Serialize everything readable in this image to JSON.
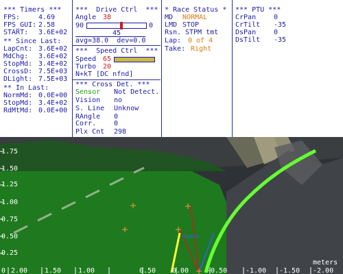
{
  "timers": {
    "header": "*** Timers ***",
    "rows": [
      {
        "label": "FPS:",
        "value": "4.69"
      },
      {
        "label": "FPS_GUI:",
        "value": "2.58"
      },
      {
        "label": "START:",
        "value": "3.6E+02"
      }
    ],
    "since_header": "** Since Last:",
    "since_rows": [
      {
        "label": "LapCnt:",
        "value": "3.6E+02"
      },
      {
        "label": "MdChg:",
        "value": "3.6E+02"
      },
      {
        "label": "StopMd:",
        "value": "3.4E+02"
      },
      {
        "label": "CrossD:",
        "value": "7.5E+03"
      },
      {
        "label": "DLight:",
        "value": "7.5E+03"
      }
    ],
    "in_header": "** In Last:",
    "in_rows": [
      {
        "label": "NormMd:",
        "value": "0.0E+00"
      },
      {
        "label": "StopMd:",
        "value": "3.4E+02"
      },
      {
        "label": "RdMtMd:",
        "value": "0.0E+00"
      }
    ]
  },
  "drive": {
    "header": "***  Drive Ctrl  ***",
    "angle_label": "Angle",
    "angle_value": "38",
    "slider_min": "90",
    "slider_max": "0",
    "slider_level": 0.58,
    "slider_center": "45",
    "avg_text": "avg=38.0  dev=0.0",
    "speed_header": "***  Speed Ctrl  ***",
    "speed_label": "Speed",
    "speed_value": "65",
    "speed_level": 1.0,
    "turbo_label": "Turbo",
    "turbo_value": "20",
    "nkt_text": "N+kT [DC nfnd]",
    "cross_header": "*** Cross Det. ***",
    "cross_rows": [
      {
        "label": "Sensor",
        "value": "Not Detect."
      },
      {
        "label": "Vision",
        "value": "no"
      },
      {
        "label": "S. Line",
        "value": "Unknow"
      },
      {
        "label": "RAngle",
        "value": "0"
      },
      {
        "label": "Corr.",
        "value": "0"
      },
      {
        "label": "Plx Cnt",
        "value": "298"
      }
    ]
  },
  "race": {
    "header": "* Race Status *",
    "rows": [
      {
        "label": "MD",
        "value": "NORMAL"
      },
      {
        "label": "LMD",
        "value": "STOP"
      },
      {
        "label": "Rsn.",
        "value": "STPM tmt"
      },
      {
        "label": "Lap:",
        "value": "0 of 4"
      },
      {
        "label": "Take:",
        "value": "Right"
      }
    ]
  },
  "ptu": {
    "header": "*** PTU ***",
    "rows": [
      {
        "label": "CrPan",
        "value": "0"
      },
      {
        "label": "CrTilt",
        "value": "-35"
      },
      {
        "label": "DsPan",
        "value": "0"
      },
      {
        "label": "DsTilt",
        "value": "-35"
      }
    ]
  },
  "view": {
    "y_ticks": [
      "1.75",
      "1.50",
      "1.25",
      "1.00",
      "0.75",
      "0.50",
      "0.25"
    ],
    "x_ticks": [
      "2.00",
      "1.50",
      "1.00",
      "0.50",
      "0.00",
      "-0.50",
      "-1.00",
      "-1.50",
      "-2.00"
    ],
    "partial_left_tick": "0",
    "units": "meters",
    "overlay_label": "Ponto",
    "colors": {
      "grass": "#1f7a1f",
      "road": "#404448",
      "track_line": "#66ff33",
      "heading": "#ffff33",
      "marker": "#ff9933"
    }
  }
}
